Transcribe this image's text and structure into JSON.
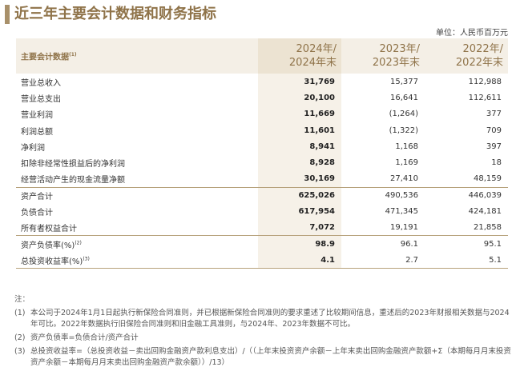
{
  "title": "近三年主要会计数据和财务指标",
  "unit": "单位：人民币百万元",
  "header": {
    "label": "主要会计数据",
    "label_sup": "(1)",
    "cols": [
      {
        "l1": "2024年/",
        "l2": "2024年末"
      },
      {
        "l1": "2023年/",
        "l2": "2023年末"
      },
      {
        "l1": "2022年/",
        "l2": "2022年末"
      }
    ]
  },
  "rows": [
    {
      "label": "营业总收入",
      "sup": "",
      "v": [
        "31,769",
        "15,377",
        "112,988"
      ]
    },
    {
      "label": "营业总支出",
      "sup": "",
      "v": [
        "20,100",
        "16,641",
        "112,611"
      ]
    },
    {
      "label": "营业利润",
      "sup": "",
      "v": [
        "11,669",
        "(1,264)",
        "377"
      ]
    },
    {
      "label": "利润总额",
      "sup": "",
      "v": [
        "11,601",
        "(1,322)",
        "709"
      ]
    },
    {
      "label": "净利润",
      "sup": "",
      "v": [
        "8,941",
        "1,168",
        "397"
      ]
    },
    {
      "label": "扣除非经常性损益后的净利润",
      "sup": "",
      "v": [
        "8,928",
        "1,169",
        "18"
      ]
    },
    {
      "label": "经营活动产生的现金流量净额",
      "sup": "",
      "v": [
        "30,169",
        "27,410",
        "48,159"
      ]
    },
    {
      "label": "资产合计",
      "sup": "",
      "v": [
        "625,026",
        "490,536",
        "446,039"
      ]
    },
    {
      "label": "负债合计",
      "sup": "",
      "v": [
        "617,954",
        "471,345",
        "424,181"
      ]
    },
    {
      "label": "所有者权益合计",
      "sup": "",
      "v": [
        "7,072",
        "19,191",
        "21,858"
      ]
    },
    {
      "label": "资产负债率(%)",
      "sup": "(2)",
      "v": [
        "98.9",
        "96.1",
        "95.1"
      ]
    },
    {
      "label": "总投资收益率(%)",
      "sup": "(3)",
      "v": [
        "4.1",
        "2.7",
        "5.1"
      ]
    }
  ],
  "notes_title": "注：",
  "notes": [
    {
      "n": "(1)",
      "t": "本公司于2024年1月1日起执行新保险合同准则，并已根据新保险合同准则的要求重述了比较期间信息，重述后的2023年财报相关数据与2024年可比。2022年数据执行旧保险合同准则和旧金融工具准则，与2024年、2023年数据不可比。"
    },
    {
      "n": "(2)",
      "t": "资产负债率=负债合计/资产合计"
    },
    {
      "n": "(3)",
      "t": "总投资收益率=（总投资收益－卖出回购金融资产款利息支出）/（（上年末投资资产余额－上年末卖出回购金融资产款额+Σ（本期每月月末投资资产余额－本期每月月末卖出回购金融资产款余额））/13）"
    }
  ],
  "colors": {
    "accent": "#8f7349",
    "header_bg": "#f4efe6",
    "current_col_bg": "#f6f1e8"
  }
}
